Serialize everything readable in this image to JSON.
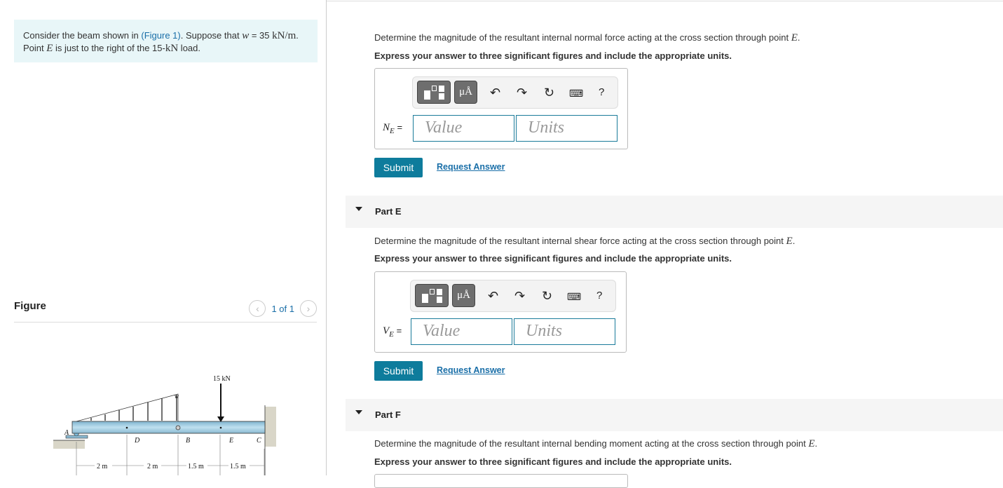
{
  "problem": {
    "text1": "Consider the beam shown in ",
    "figure_link": "(Figure 1)",
    "text2": ". Suppose that ",
    "w_var": "w",
    "text3": " = 35 ",
    "w_unit": "kN/m",
    "text4": ".",
    "line2_a": "Point ",
    "line2_E": "E",
    "line2_b": " is just to the right of the 15-",
    "line2_kN": "kN",
    "line2_c": " load."
  },
  "figure": {
    "title": "Figure",
    "pagination": "1 of 1",
    "labels": {
      "force": "15 kN",
      "w": "w",
      "A": "A",
      "B": "B",
      "C": "C",
      "D": "D",
      "E": "E",
      "d1": "2 m",
      "d2": "2 m",
      "d3": "1.5 m",
      "d4": "1.5 m"
    }
  },
  "parts": [
    {
      "question": "Determine the magnitude of the resultant internal normal force acting at the cross section through point ",
      "point": "E",
      "instruction": "Express your answer to three significant figures and include the appropriate units.",
      "var": "N",
      "sub": "E",
      "value_placeholder": "Value",
      "units_placeholder": "Units",
      "submit": "Submit",
      "request": "Request Answer"
    },
    {
      "title": "Part E",
      "question": "Determine the magnitude of the resultant internal shear force acting at the cross section through point ",
      "point": "E",
      "instruction": "Express your answer to three significant figures and include the appropriate units.",
      "var": "V",
      "sub": "E",
      "value_placeholder": "Value",
      "units_placeholder": "Units",
      "submit": "Submit",
      "request": "Request Answer"
    },
    {
      "title": "Part F",
      "question": "Determine the magnitude of the resultant internal bending moment acting at the cross section through point ",
      "point": "E",
      "instruction": "Express your answer to three significant figures and include the appropriate units."
    }
  ],
  "toolbar": {
    "units_btn": "μÅ",
    "help": "?",
    "icons": [
      "templates-icon",
      "units-icon",
      "undo-icon",
      "redo-icon",
      "reset-icon",
      "keyboard-icon",
      "help-icon"
    ]
  },
  "colors": {
    "accent": "#0e7c9c",
    "link": "#1a6fa8",
    "problem_bg": "#e8f6f8"
  }
}
